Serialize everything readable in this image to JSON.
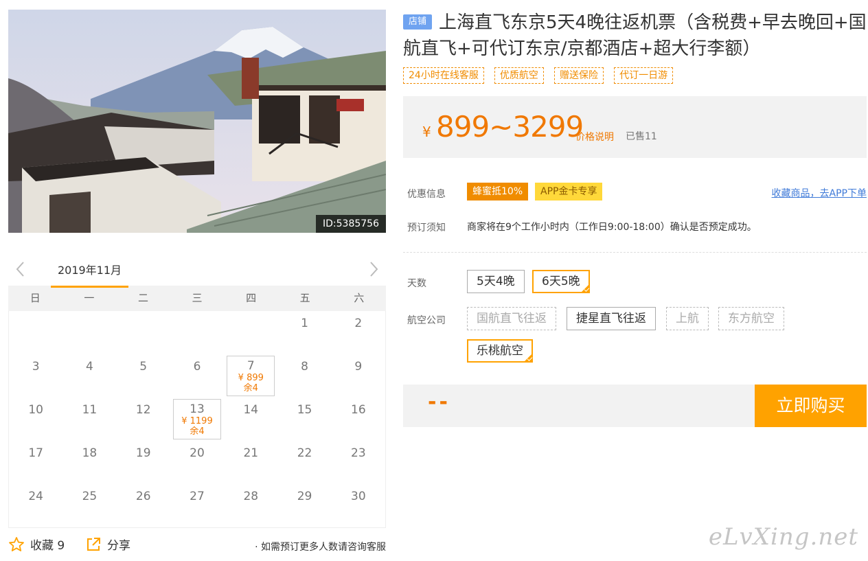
{
  "photo": {
    "id_label": "ID:5385756"
  },
  "calendar": {
    "month": "2019年11月",
    "weekdays": [
      "日",
      "一",
      "二",
      "三",
      "四",
      "五",
      "六"
    ],
    "days": [
      {
        "d": ""
      },
      {
        "d": ""
      },
      {
        "d": ""
      },
      {
        "d": ""
      },
      {
        "d": ""
      },
      {
        "d": "1"
      },
      {
        "d": "2"
      },
      {
        "d": "3"
      },
      {
        "d": "4"
      },
      {
        "d": "5"
      },
      {
        "d": "6"
      },
      {
        "d": "7",
        "price": "¥ 899",
        "stock": "余4"
      },
      {
        "d": "8"
      },
      {
        "d": "9"
      },
      {
        "d": "10"
      },
      {
        "d": "11"
      },
      {
        "d": "12"
      },
      {
        "d": "13",
        "price": "¥ 1199",
        "stock": "余4"
      },
      {
        "d": "14"
      },
      {
        "d": "15"
      },
      {
        "d": "16"
      },
      {
        "d": "17"
      },
      {
        "d": "18"
      },
      {
        "d": "19"
      },
      {
        "d": "20"
      },
      {
        "d": "21"
      },
      {
        "d": "22"
      },
      {
        "d": "23"
      },
      {
        "d": "24"
      },
      {
        "d": "25"
      },
      {
        "d": "26"
      },
      {
        "d": "27"
      },
      {
        "d": "28"
      },
      {
        "d": "29"
      },
      {
        "d": "30"
      }
    ]
  },
  "actions": {
    "fav_label": "收藏 9",
    "share_label": "分享",
    "tip": "· 如需预订更多人数请咨询客服"
  },
  "product": {
    "shop_badge": "店铺",
    "title": "上海直飞东京5天4晚往返机票（含税费+早去晚回+国航直飞+可代订东京/京都酒店+超大行李额）",
    "tags": [
      "24小时在线客服",
      "优质航空",
      "赠送保险",
      "代订一日游"
    ]
  },
  "price": {
    "currency": "¥",
    "range": "899~3299",
    "note": "价格说明",
    "sold": "已售11"
  },
  "promo": {
    "label": "优惠信息",
    "tag1": "蜂蜜抵10%",
    "tag2": "APP金卡专享",
    "fav_link": "收藏商品，去APP下单"
  },
  "notice": {
    "label": "预订须知",
    "text": "商家将在9个工作小时内（工作日9:00-18:00）确认是否预定成功。"
  },
  "options": {
    "days_label": "天数",
    "days": [
      {
        "label": "5天4晚",
        "state": "normal"
      },
      {
        "label": "6天5晚",
        "state": "selected"
      }
    ],
    "airline_label": "航空公司",
    "airlines": [
      {
        "label": "国航直飞往返",
        "state": "disabled"
      },
      {
        "label": "捷星直飞往返",
        "state": "normal"
      },
      {
        "label": "上航",
        "state": "disabled"
      },
      {
        "label": "东方航空",
        "state": "disabled"
      },
      {
        "label": "乐桃航空",
        "state": "selected"
      }
    ]
  },
  "buy": {
    "price_placeholder": "--",
    "button": "立即购买"
  },
  "watermark": "eLvXing.net",
  "colors": {
    "accent": "#ffa200",
    "price": "#f07800",
    "link": "#3f7ad8",
    "badge": "#6fa3f0"
  }
}
